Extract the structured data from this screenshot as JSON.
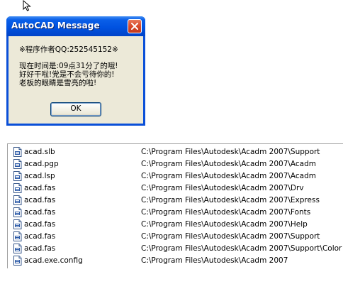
{
  "dialog": {
    "title": "AutoCAD Message",
    "lines": [
      "※程序作者QQ:252545152※",
      "现在时间是:09点31分了的哦!",
      "好好干啦!党是不会亏待你的!",
      "老板的眼睛是雪亮的啦!"
    ],
    "ok_label": "OK"
  },
  "files": [
    {
      "name": "acad.slb",
      "path": "C:\\Program Files\\Autodesk\\Acadm 2007\\Support"
    },
    {
      "name": "acad.pgp",
      "path": "C:\\Program Files\\Autodesk\\Acadm 2007\\Acadm"
    },
    {
      "name": "acad.lsp",
      "path": "C:\\Program Files\\Autodesk\\Acadm 2007\\Acadm"
    },
    {
      "name": "acad.fas",
      "path": "C:\\Program Files\\Autodesk\\Acadm 2007\\Drv"
    },
    {
      "name": "acad.fas",
      "path": "C:\\Program Files\\Autodesk\\Acadm 2007\\Express"
    },
    {
      "name": "acad.fas",
      "path": "C:\\Program Files\\Autodesk\\Acadm 2007\\Fonts"
    },
    {
      "name": "acad.fas",
      "path": "C:\\Program Files\\Autodesk\\Acadm 2007\\Help"
    },
    {
      "name": "acad.fas",
      "path": "C:\\Program Files\\Autodesk\\Acadm 2007\\Support"
    },
    {
      "name": "acad.fas",
      "path": "C:\\Program Files\\Autodesk\\Acadm 2007\\Support\\Color"
    },
    {
      "name": "acad.exe.config",
      "path": "C:\\Program Files\\Autodesk\\Acadm 2007"
    }
  ],
  "icons": {
    "cursor": "mouse-pointer-icon",
    "close": "close-icon",
    "file": "file-icon"
  },
  "colors": {
    "titlebar": "#0052e0",
    "close_button": "#d8492a",
    "dialog_background": "#ece9d8"
  }
}
